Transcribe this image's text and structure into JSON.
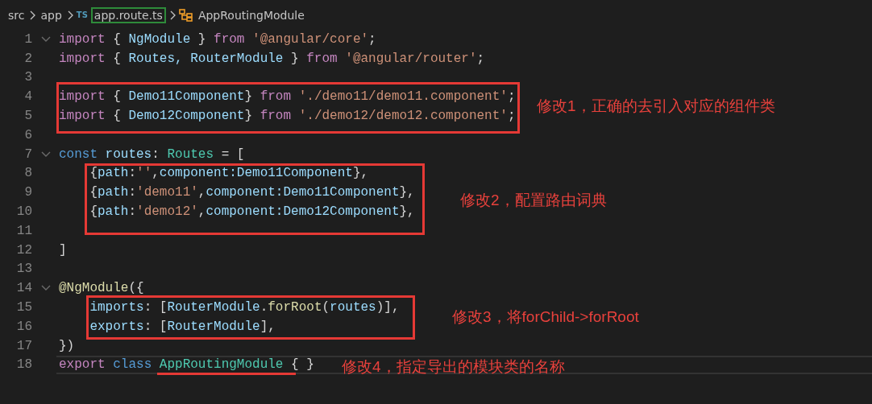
{
  "breadcrumb": {
    "items": [
      {
        "kind": "folder",
        "label": "src",
        "highlighted": false
      },
      {
        "kind": "folder",
        "label": "app",
        "highlighted": false
      },
      {
        "kind": "file",
        "badge": "TS",
        "label": "app.route.ts",
        "highlighted": true
      },
      {
        "kind": "symbol",
        "label": "AppRoutingModule",
        "highlighted": false
      }
    ]
  },
  "editor": {
    "lines": [
      {
        "number": "1",
        "foldable": true,
        "current": false,
        "tokens": [
          {
            "kind": "keyword",
            "text": "import"
          },
          {
            "kind": "punct",
            "text": " { "
          },
          {
            "kind": "ident",
            "text": "NgModule"
          },
          {
            "kind": "punct",
            "text": " } "
          },
          {
            "kind": "keyword",
            "text": "from "
          },
          {
            "kind": "string",
            "text": "'@angular/core'"
          },
          {
            "kind": "punct",
            "text": ";"
          }
        ]
      },
      {
        "number": "2",
        "foldable": false,
        "current": false,
        "tokens": [
          {
            "kind": "keyword",
            "text": "import"
          },
          {
            "kind": "punct",
            "text": " { "
          },
          {
            "kind": "ident",
            "text": "Routes, RouterModule"
          },
          {
            "kind": "punct",
            "text": " } "
          },
          {
            "kind": "keyword",
            "text": "from "
          },
          {
            "kind": "string",
            "text": "'@angular/router'"
          },
          {
            "kind": "punct",
            "text": ";"
          }
        ]
      },
      {
        "number": "3",
        "foldable": false,
        "current": false
      },
      {
        "number": "4",
        "foldable": false,
        "current": false,
        "tokens": [
          {
            "kind": "keyword",
            "text": "import"
          },
          {
            "kind": "punct",
            "text": " { "
          },
          {
            "kind": "ident",
            "text": "Demo11Component"
          },
          {
            "kind": "punct",
            "text": "} "
          },
          {
            "kind": "keyword",
            "text": "from "
          },
          {
            "kind": "string",
            "text": "'./demo11/demo11.component'"
          },
          {
            "kind": "punct",
            "text": ";"
          }
        ]
      },
      {
        "number": "5",
        "foldable": false,
        "current": false,
        "tokens": [
          {
            "kind": "keyword",
            "text": "import"
          },
          {
            "kind": "punct",
            "text": " { "
          },
          {
            "kind": "ident",
            "text": "Demo12Component"
          },
          {
            "kind": "punct",
            "text": "} "
          },
          {
            "kind": "keyword",
            "text": "from "
          },
          {
            "kind": "string",
            "text": "'./demo12/demo12.component'"
          },
          {
            "kind": "punct",
            "text": ";"
          }
        ]
      },
      {
        "number": "6",
        "foldable": false,
        "current": false
      },
      {
        "number": "7",
        "foldable": true,
        "current": false,
        "tokens": [
          {
            "kind": "storage",
            "text": "const "
          },
          {
            "kind": "ident",
            "text": "routes"
          },
          {
            "kind": "punct",
            "text": ": "
          },
          {
            "kind": "type",
            "text": "Routes"
          },
          {
            "kind": "punct",
            "text": " = ["
          }
        ]
      },
      {
        "number": "8",
        "foldable": false,
        "current": false,
        "tokens": [
          {
            "kind": "punct",
            "text": "    {"
          },
          {
            "kind": "ident",
            "text": "path"
          },
          {
            "kind": "punct",
            "text": ":"
          },
          {
            "kind": "string",
            "text": "''"
          },
          {
            "kind": "punct",
            "text": ","
          },
          {
            "kind": "ident",
            "text": "component:Demo11Component"
          },
          {
            "kind": "punct",
            "text": "},"
          }
        ]
      },
      {
        "number": "9",
        "foldable": false,
        "current": false,
        "tokens": [
          {
            "kind": "punct",
            "text": "    {"
          },
          {
            "kind": "ident",
            "text": "path"
          },
          {
            "kind": "punct",
            "text": ":"
          },
          {
            "kind": "string",
            "text": "'demo11'"
          },
          {
            "kind": "punct",
            "text": ","
          },
          {
            "kind": "ident",
            "text": "component:Demo11Component"
          },
          {
            "kind": "punct",
            "text": "},"
          }
        ]
      },
      {
        "number": "10",
        "foldable": false,
        "current": false,
        "tokens": [
          {
            "kind": "punct",
            "text": "    {"
          },
          {
            "kind": "ident",
            "text": "path"
          },
          {
            "kind": "punct",
            "text": ":"
          },
          {
            "kind": "string",
            "text": "'demo12'"
          },
          {
            "kind": "punct",
            "text": ","
          },
          {
            "kind": "ident",
            "text": "component:Demo12Component"
          },
          {
            "kind": "punct",
            "text": "},"
          }
        ]
      },
      {
        "number": "11",
        "foldable": false,
        "current": false
      },
      {
        "number": "12",
        "foldable": false,
        "current": false,
        "tokens": [
          {
            "kind": "punct",
            "text": "]"
          }
        ]
      },
      {
        "number": "13",
        "foldable": false,
        "current": false
      },
      {
        "number": "14",
        "foldable": true,
        "current": false,
        "tokens": [
          {
            "kind": "func",
            "text": "@NgModule"
          },
          {
            "kind": "punct",
            "text": "({"
          }
        ]
      },
      {
        "number": "15",
        "foldable": false,
        "current": false,
        "tokens": [
          {
            "kind": "ident",
            "text": "    imports"
          },
          {
            "kind": "punct",
            "text": ": ["
          },
          {
            "kind": "ident",
            "text": "RouterModule"
          },
          {
            "kind": "punct",
            "text": "."
          },
          {
            "kind": "func",
            "text": "forRoot"
          },
          {
            "kind": "punct",
            "text": "("
          },
          {
            "kind": "ident",
            "text": "routes"
          },
          {
            "kind": "punct",
            "text": ")],"
          }
        ]
      },
      {
        "number": "16",
        "foldable": false,
        "current": false,
        "tokens": [
          {
            "kind": "ident",
            "text": "    exports"
          },
          {
            "kind": "punct",
            "text": ": ["
          },
          {
            "kind": "ident",
            "text": "RouterModule"
          },
          {
            "kind": "punct",
            "text": "],"
          }
        ]
      },
      {
        "number": "17",
        "foldable": false,
        "current": false,
        "tokens": [
          {
            "kind": "punct",
            "text": "})"
          }
        ]
      },
      {
        "number": "18",
        "foldable": false,
        "current": true,
        "tokens": [
          {
            "kind": "keyword",
            "text": "export "
          },
          {
            "kind": "storage",
            "text": "class "
          },
          {
            "kind": "type",
            "text": "AppRoutingModule"
          },
          {
            "kind": "punct",
            "text": " { }"
          }
        ]
      }
    ]
  },
  "annotations": [
    {
      "kind": "box",
      "note": "修改1，正确的去引入对应的组件类"
    },
    {
      "kind": "box",
      "note": "修改2，配置路由词典"
    },
    {
      "kind": "box",
      "note": "修改3，将forChild->forRoot"
    },
    {
      "kind": "underline",
      "note": "修改4，指定导出的模块类的名称"
    }
  ]
}
